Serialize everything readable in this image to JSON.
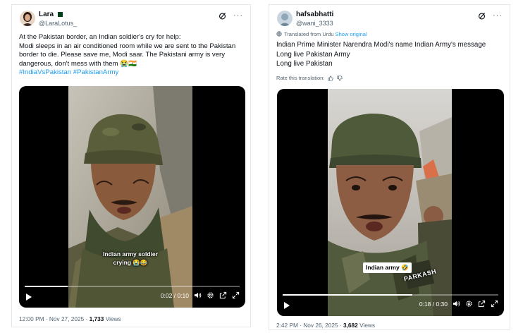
{
  "tweets": [
    {
      "user": {
        "display_name": "Lara",
        "handle": "@LaraLotus_"
      },
      "text_lines": [
        "At the Pakistan border, an Indian soldier's cry for help:",
        "Modi sleeps in an air conditioned room while we are sent to the Pakistan border to die. Please save me, Modi saar. The Pakistani army is very dangerous, don't mess with them 😭🇮🇳"
      ],
      "hashtags": "#IndiaVsPakistan #PakistanArmy",
      "video": {
        "caption": "Indian army soldier crying 😭😂",
        "time": "0:02 / 0:10",
        "progress": 0.2
      },
      "footer": {
        "timestamp": "12:00 PM · Nov 27, 2025 · ",
        "views_count": "1,733",
        "views_label": " Views"
      }
    },
    {
      "user": {
        "display_name": "hafsabhatti",
        "handle": "@wani_3333"
      },
      "translated_label": "Translated from Urdu",
      "show_original": "Show original",
      "text_lines": [
        "Indian Prime Minister Narendra Modi's name Indian Army's message",
        "Long live Pakistan Army",
        "Long live Pakistan"
      ],
      "rate_label": "Rate this translation:",
      "video": {
        "caption": "Indian army 🤣",
        "name_tag": "PARKASH",
        "time": "0:18 / 0:30",
        "progress": 0.6
      },
      "footer": {
        "timestamp": "2:42 PM · Nov 26, 2025 · ",
        "views_count": "3,682",
        "views_label": " Views"
      }
    }
  ],
  "colors": {
    "link": "#1d9bf0",
    "muted": "#536471",
    "text": "#0f1419",
    "video_bg": "#000000"
  },
  "icons": [
    "grok-icon",
    "more-icon",
    "play-icon",
    "volume-icon",
    "settings-icon",
    "pip-icon",
    "fullscreen-icon",
    "thumbs-up-icon",
    "thumbs-down-icon",
    "translate-icon"
  ]
}
